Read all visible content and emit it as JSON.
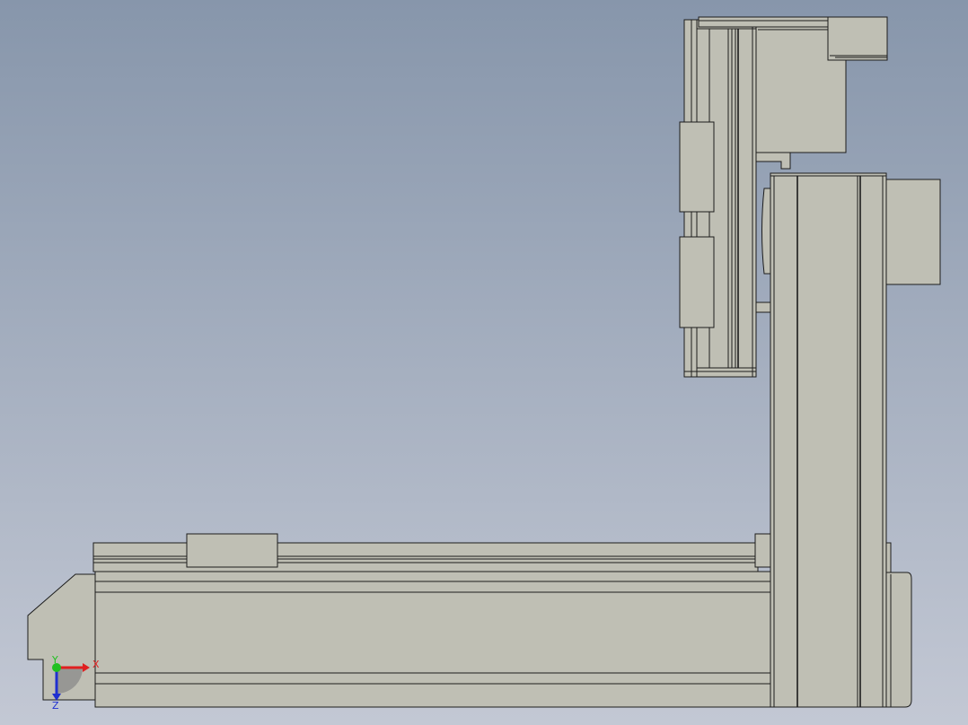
{
  "viewport": {
    "background_top": "#8796ab",
    "background_bottom": "#c3c8d4",
    "part_color": "#bfbfb4",
    "edge_color": "#1c1c1c"
  },
  "triad": {
    "x_label": "X",
    "y_label": "Y",
    "z_label": "Z",
    "x_color": "#e02020",
    "y_color": "#20c020",
    "z_color": "#2030d0"
  }
}
